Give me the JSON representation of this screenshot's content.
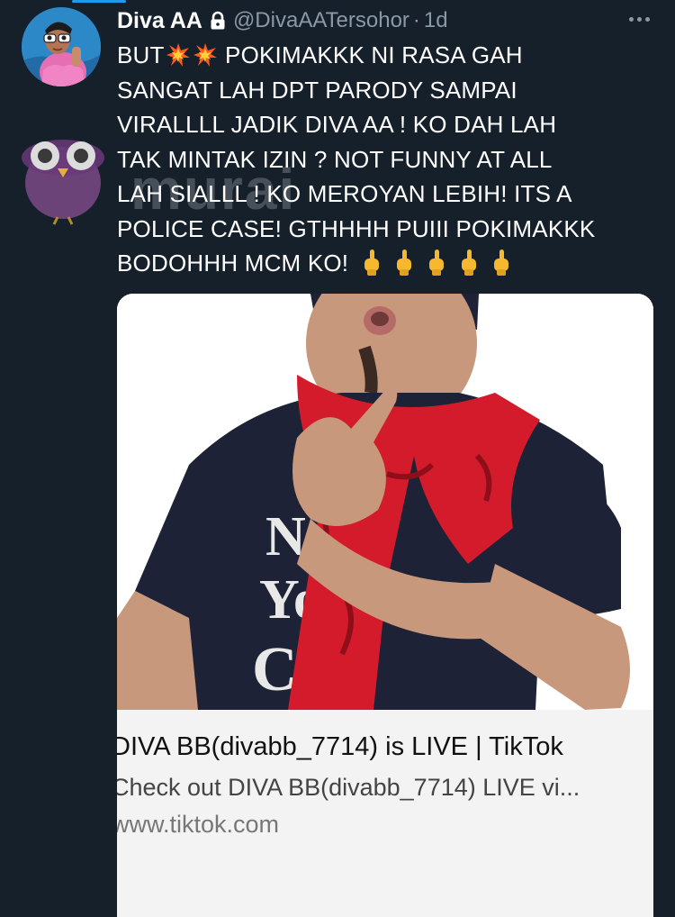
{
  "tweet": {
    "author_name": "Diva AA",
    "handle": "@DivaAATersohor",
    "separator": "·",
    "time": "1d",
    "lines": [
      "POKIMAKKK NI RASA GAH",
      "SANGAT LAH DPT PARODY SAMPAI",
      "VIRALLLL JADIK DIVA AA ! KO DAH LAH",
      "TAK MINTAK IZIN ?  NOT FUNNY AT ALL",
      "LAH SIALLL ! KO MEROYAN LEBIH!  ITS A",
      "POLICE CASE! GTHHHH PUIII POKIMAKKK",
      "BODOHHH MCM KO!"
    ],
    "first_line_prefix": "BUT",
    "icons": {
      "lock": "lock-icon",
      "more": "more-options-icon",
      "boom": "collision-emoji",
      "finger": "middle-finger-emoji"
    }
  },
  "watermark": {
    "text": "murai"
  },
  "card": {
    "title": "DIVA BB(divabb_7714) is LIVE | TikTok",
    "description": "Check out DIVA BB(divabb_7714) LIVE vi...",
    "domain": "www.tiktok.com",
    "shirt_text": "New York City"
  },
  "colors": {
    "background": "#15202b",
    "secondary_text": "#8b98a5",
    "scarf_red": "#d41b2b",
    "shirt_navy": "#1d2236"
  }
}
